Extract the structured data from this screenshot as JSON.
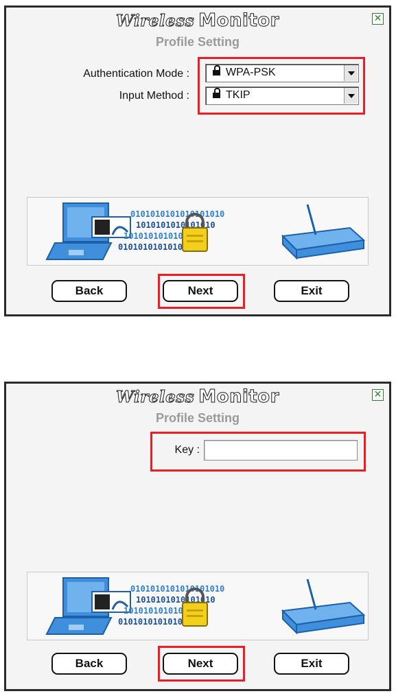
{
  "app_title_script": "Wireless",
  "app_title_main": "Monitor",
  "close_glyph": "✕",
  "screens": [
    {
      "subtitle": "Profile Setting",
      "auth_label": "Authentication Mode :",
      "auth_value": "WPA-PSK",
      "input_label": "Input Method :",
      "input_value": "TKIP",
      "buttons": {
        "back": "Back",
        "next": "Next",
        "exit": "Exit"
      }
    },
    {
      "subtitle": "Profile Setting",
      "key_label": "Key :",
      "key_value": "",
      "buttons": {
        "back": "Back",
        "next": "Next",
        "exit": "Exit"
      }
    }
  ],
  "banner_binary": [
    "0101010101010101010",
    "1010101010101010",
    "1010101010101010",
    "01010101010101010"
  ],
  "colors": {
    "highlight": "#ee1c24",
    "icon_blue": "#2f7fd0",
    "subtitle": "#9a9a9a"
  }
}
